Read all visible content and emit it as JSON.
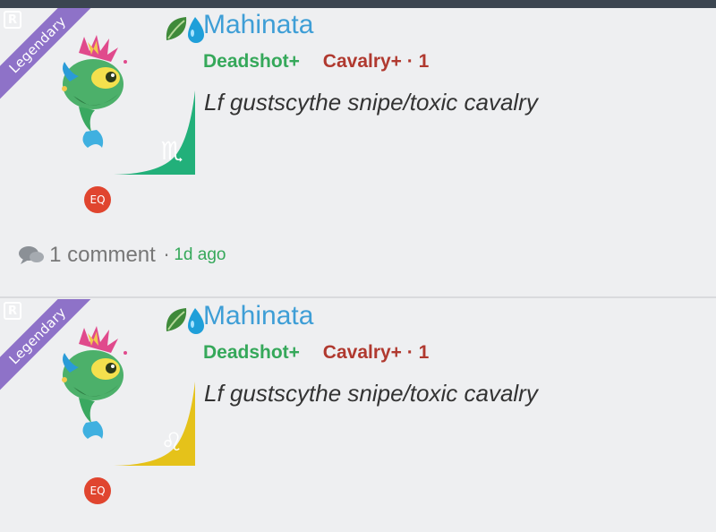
{
  "colors": {
    "accent_blue": "#3e9ed6",
    "green": "#35a85a",
    "red": "#b0392f",
    "legendary_purple": "#8e72c8",
    "eq_red": "#e0452f"
  },
  "posts": [
    {
      "rarity": "Legendary",
      "r_badge": "R",
      "username": "Mahinata",
      "species_icons": [
        "leaf-icon",
        "water-drop-icon"
      ],
      "tag_green": "Deadshot+",
      "tag_red": "Cavalry+ · 1",
      "title": "Lf gustscythe snipe/toxic cavalry",
      "sign_glyph": "♏",
      "sign_icon": "scorpio-sign-icon",
      "sign_color": "#22b07a",
      "eq": "EQ",
      "comment_count": "1 comment",
      "separator": "·",
      "time": "1d ago"
    },
    {
      "rarity": "Legendary",
      "r_badge": "R",
      "username": "Mahinata",
      "species_icons": [
        "leaf-icon",
        "water-drop-icon"
      ],
      "tag_green": "Deadshot+",
      "tag_red": "Cavalry+ · 1",
      "title": "Lf gustscythe snipe/toxic cavalry",
      "sign_glyph": "♌",
      "sign_icon": "leo-sign-icon",
      "sign_color": "#e5c21a",
      "eq": "EQ"
    }
  ]
}
